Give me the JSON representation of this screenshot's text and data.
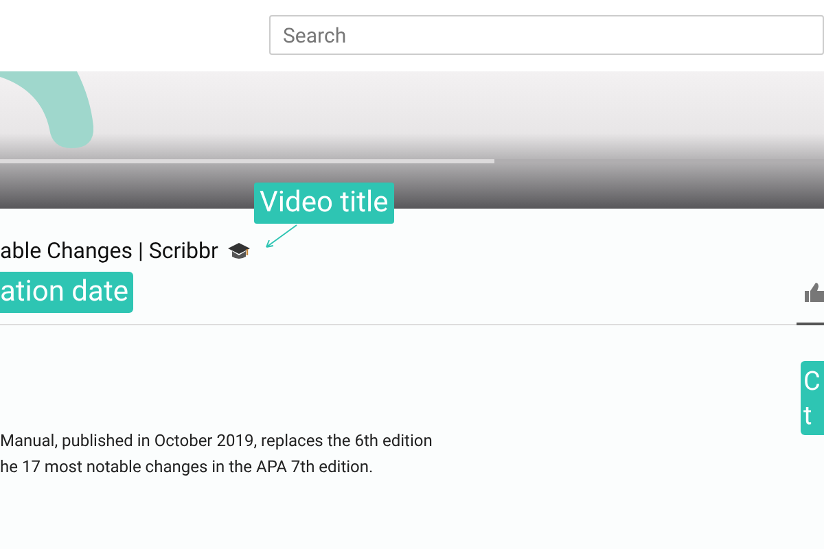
{
  "search": {
    "placeholder": "Search"
  },
  "player": {
    "progress": {
      "level": 0.6
    }
  },
  "video": {
    "title": "able Changes | Scribbr",
    "description": [
      "Manual, published in October 2019, replaces the 6th edition",
      "he 17 most notable changes in the APA 7th edition."
    ]
  },
  "annotations": [
    {
      "text": "Video title"
    },
    {
      "text": "ation date"
    },
    {
      "text": "C\nt"
    }
  ]
}
